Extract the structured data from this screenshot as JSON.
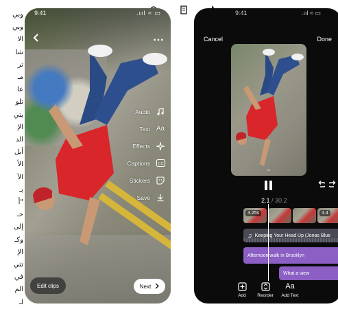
{
  "toolbar": {
    "icons": [
      "zoom-icon",
      "page-icon",
      "rotate-icon"
    ]
  },
  "arabic_lines": [
    "وبي",
    "وبي",
    "الا",
    "شا",
    "تر",
    "مـ",
    "عا",
    "تلو",
    "يتي",
    "الإ",
    "الد",
    "أبل",
    "الأ",
    "الآ",
    "بـ",
    "\"أ",
    "حـ",
    "إلى",
    "وكـ",
    "الإ",
    "تتي",
    "في",
    "الم",
    "لـ"
  ],
  "phone1": {
    "time": "9:41",
    "status_icons": ".ııl ≈ ▭",
    "menu": [
      {
        "label": "Audio",
        "icon": "music-note-icon"
      },
      {
        "label": "Text",
        "icon": "text-aa-icon"
      },
      {
        "label": "Effects",
        "icon": "sparkle-icon"
      },
      {
        "label": "Captions",
        "icon": "cc-icon"
      },
      {
        "label": "Stickers",
        "icon": "sticker-icon"
      },
      {
        "label": "Save",
        "icon": "download-icon"
      }
    ],
    "edit_clips_label": "Edit clips",
    "next_label": "Next"
  },
  "phone2": {
    "time": "9:41",
    "status_icons": ".ııl ≈ ▭",
    "cancel_label": "Cancel",
    "done_label": "Done",
    "timecode_current": "2.1",
    "timecode_total": " / 30.2",
    "clips": [
      {
        "duration": "3.25s"
      },
      {
        "duration": ""
      },
      {
        "duration": ""
      },
      {
        "duration": "3.4"
      }
    ],
    "music_track": "Keeping Your Head Up (Jonas Blue",
    "text_tracks": [
      "Afternoon walk in Brooklyn",
      "What a view"
    ],
    "tools": [
      {
        "label": "Add",
        "icon": "add-clip-icon"
      },
      {
        "label": "Reorder",
        "icon": "reorder-icon"
      },
      {
        "label": "Add Text",
        "icon": "text-aa-icon"
      }
    ]
  },
  "colors": {
    "accent_purple": "#8b5fc4",
    "phone_bg": "#0b0b0c",
    "shirt_red": "#d8262a",
    "jeans_blue": "#2a4a86"
  }
}
